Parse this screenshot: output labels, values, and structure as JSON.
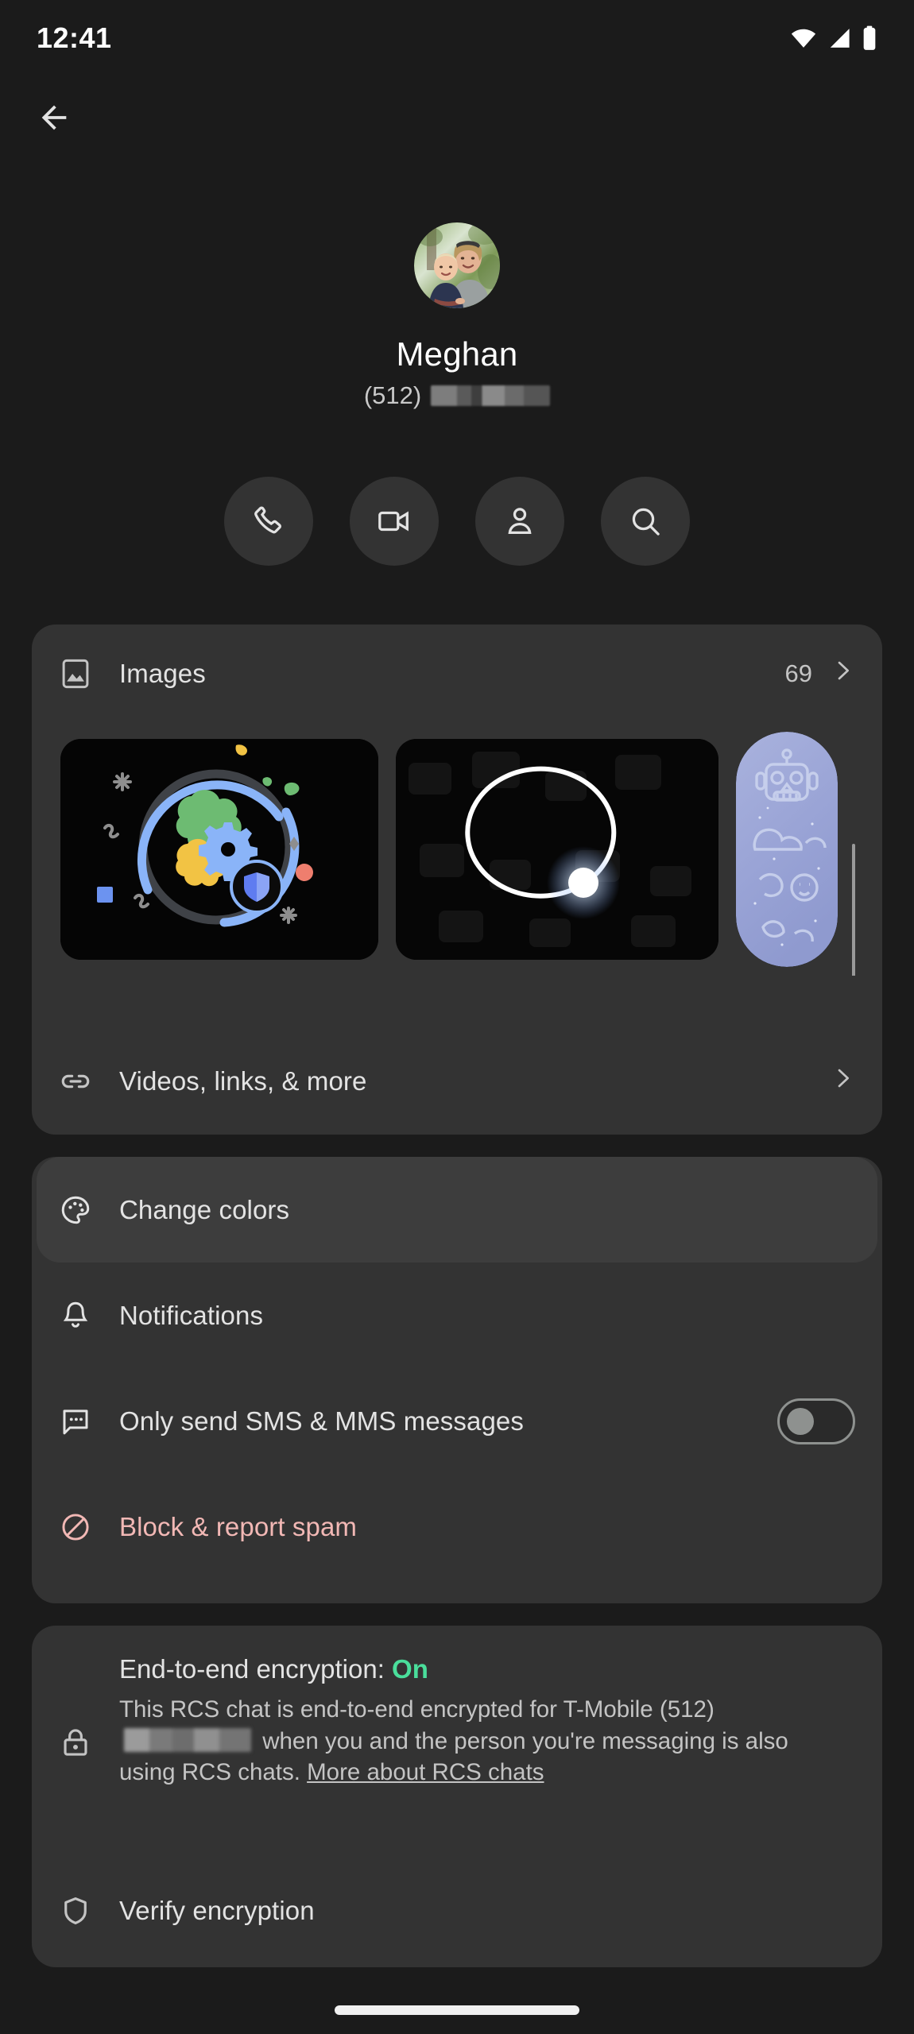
{
  "status_bar": {
    "time": "12:41",
    "icons": [
      "wifi-icon",
      "cellular-signal-icon",
      "battery-icon"
    ]
  },
  "app_bar": {
    "back_label": "Back",
    "back_icon": "arrow-back-icon"
  },
  "profile": {
    "avatar_alt": "Contact photo of a woman and a small child outdoors",
    "name": "Meghan",
    "phone_prefix": "(512)",
    "phone_redacted": true
  },
  "quick_actions": [
    {
      "name": "call",
      "label": "Call",
      "icon": "phone-icon"
    },
    {
      "name": "video-call",
      "label": "Video call",
      "icon": "video-camera-icon"
    },
    {
      "name": "contact-info",
      "label": "Contact info",
      "icon": "person-icon"
    },
    {
      "name": "search",
      "label": "Search",
      "icon": "search-icon"
    }
  ],
  "media_card": {
    "images_row": {
      "icon": "image-icon",
      "label": "Images",
      "count": "69",
      "chevron": "chevron-right-icon"
    },
    "thumbnails": [
      {
        "name": "thumb-settings-illustration",
        "alt": "Dark illustration with blue orbit ring, green, yellow and blue gears and a shield badge"
      },
      {
        "name": "thumb-light-trail",
        "alt": "Dark photo with a white circular light trail and a glowing dot"
      },
      {
        "name": "thumb-robot-sticker",
        "alt": "Lavender sticker sheet with a robot outline"
      }
    ],
    "videos_row": {
      "icon": "link-icon",
      "label": "Videos, links, & more",
      "chevron": "chevron-right-icon"
    }
  },
  "settings_card": {
    "rows": [
      {
        "name": "change-colors",
        "icon": "palette-icon",
        "label": "Change colors",
        "highlighted": true
      },
      {
        "name": "notifications",
        "icon": "bell-icon",
        "label": "Notifications",
        "highlighted": false
      },
      {
        "name": "only-sms-mms",
        "icon": "chat-bubble-icon",
        "label": "Only send SMS & MMS messages",
        "toggle": "off"
      },
      {
        "name": "block-report-spam",
        "icon": "block-icon",
        "label": "Block & report spam",
        "danger": true
      }
    ]
  },
  "encryption_card": {
    "icon": "lock-icon",
    "title_prefix": "End-to-end encryption: ",
    "status": "On",
    "description_part1": "This RCS chat is end-to-end encrypted for T-Mobile ",
    "carrier_phone_prefix": "(512)",
    "description_part2": " when you and the person you're messaging is also using RCS chats. ",
    "link_text": "More about RCS chats",
    "verify_row": {
      "icon": "shield-icon",
      "label": "Verify encryption"
    }
  },
  "colors": {
    "background": "#1b1b1b",
    "card": "#333333",
    "card_highlight": "#3d3d3d",
    "text_primary": "#e3e3e3",
    "text_secondary": "#c4c4c4",
    "danger": "#f2b8b5",
    "success": "#4ade9b"
  },
  "system_nav": {
    "gesture_bar": "home-gesture-bar"
  }
}
